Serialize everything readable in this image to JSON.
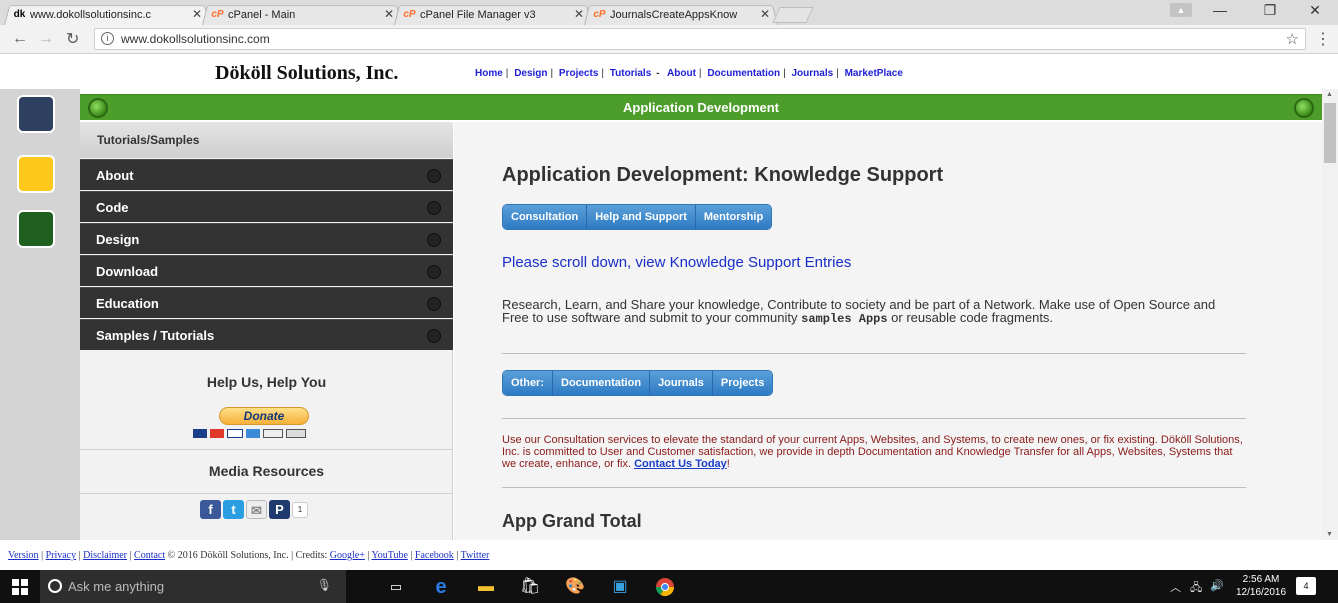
{
  "browser": {
    "tabs": [
      {
        "favicon": "dk",
        "label": "www.dokollsolutionsinc.c",
        "active": true
      },
      {
        "favicon": "cP",
        "label": "cPanel - Main",
        "active": false
      },
      {
        "favicon": "cP",
        "label": "cPanel File Manager v3",
        "active": false
      },
      {
        "favicon": "cP",
        "label": "JournalsCreateAppsKnow",
        "active": false
      }
    ],
    "url": "www.dokollsolutionsinc.com"
  },
  "site": {
    "brand": "Dököll Solutions, Inc.",
    "nav": [
      "Home",
      "Design",
      "Projects",
      "Tutorials",
      "About",
      "Documentation",
      "Journals",
      "MarketPlace"
    ]
  },
  "swatches": [
    "#2d4060",
    "#ffc81a",
    "#1f6020"
  ],
  "page_title": "Application Development",
  "sidebar": {
    "header": "Tutorials/Samples",
    "menu": [
      "About",
      "Code",
      "Design",
      "Download",
      "Education",
      "Samples / Tutorials"
    ],
    "help_title": "Help Us, Help You",
    "donate_label": "Donate",
    "media_title": "Media Resources",
    "share_count": "1"
  },
  "main": {
    "heading": "Application Development: Knowledge Support",
    "buttons1": [
      "Consultation",
      "Help and Support",
      "Mentorship"
    ],
    "scroll_message": "Please scroll down, view Knowledge Support Entries",
    "intro_1": "Research, Learn, and Share your knowledge, Contribute to society and be part of a Network. Make use of Open Source and Free to use software and submit to your community ",
    "intro_code": "samples Apps",
    "intro_2": " or reusable code fragments.",
    "buttons2": [
      "Other:",
      "Documentation",
      "Journals",
      "Projects"
    ],
    "consult_text": "Use our Consultation services to elevate the standard of your current Apps, Websites, and Systems, to create new ones, or fix existing. Dököll Solutions, Inc. is committed to User and Customer satisfaction, we provide in depth Documentation and Knowledge Transfer for all Apps, Websites, Systems that we create, enhance, or fix. ",
    "contact_link": "Contact Us Today",
    "contact_after": "!",
    "grand_total": "App Grand Total"
  },
  "footer": {
    "links": [
      "Version",
      "Privacy",
      "Disclaimer",
      "Contact"
    ],
    "copyright": "© 2016 Dököll Solutions, Inc.",
    "credits_label": "Credits:",
    "credit_links": [
      "Google+",
      "YouTube",
      "Facebook",
      "Twitter"
    ]
  },
  "taskbar": {
    "search_placeholder": "Ask me anything",
    "time": "2:56 AM",
    "date": "12/16/2016",
    "notifications": "4"
  }
}
